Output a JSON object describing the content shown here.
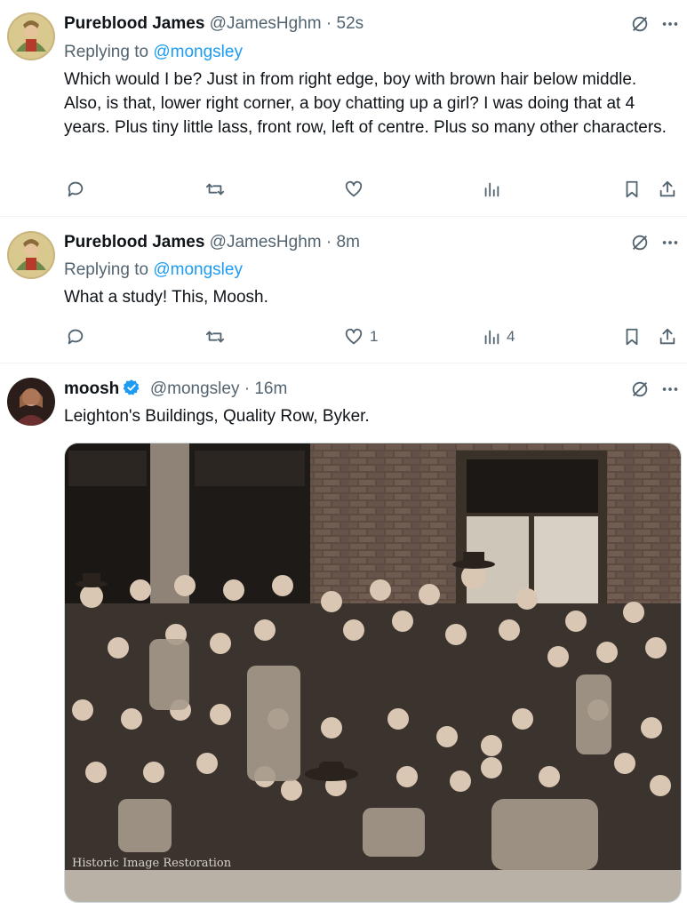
{
  "tweets": [
    {
      "name": "Pureblood James",
      "handle": "@JamesHghm",
      "time": "52s",
      "replying_prefix": "Replying to",
      "replying_to": "@mongsley",
      "text": "Which would I be? Just in from right edge, boy with brown hair below middle.  Also, is that, lower right corner, a boy chatting up a girl? I was doing that at 4 years. Plus tiny little lass, front row, left of centre. Plus so many other characters.",
      "likes": "",
      "views": ""
    },
    {
      "name": "Pureblood James",
      "handle": "@JamesHghm",
      "time": "8m",
      "replying_prefix": "Replying to",
      "replying_to": "@mongsley",
      "text": "What a study!  This, Moosh.",
      "likes": "1",
      "views": "4"
    },
    {
      "name": "moosh",
      "handle": "@mongsley",
      "time": "16m",
      "text": "Leighton's Buildings, Quality Row, Byker.",
      "verified": true
    }
  ],
  "sep": " · ",
  "watermark": "Historic Image Restoration",
  "icons": [
    "grok-icon",
    "more-icon",
    "reply-icon",
    "retweet-icon",
    "like-icon",
    "views-icon",
    "bookmark-icon",
    "share-icon",
    "verified-icon"
  ],
  "colors": {
    "accent": "#1d9bf0",
    "muted": "#536471",
    "text": "#0f1419",
    "divider": "#eff3f4"
  }
}
